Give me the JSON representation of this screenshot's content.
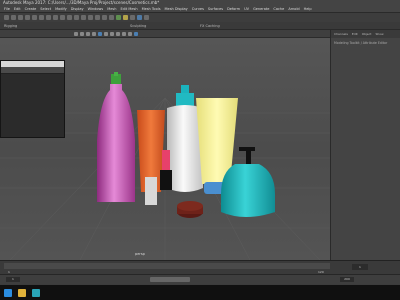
{
  "window": {
    "title": "Autodesk Maya 2017: C:/Users/.../3D/Maya Proj/Project/scenes/Cosmetics.mb*"
  },
  "menubar": {
    "items": [
      "File",
      "Edit",
      "Create",
      "Select",
      "Modify",
      "Display",
      "Windows",
      "Mesh",
      "Edit Mesh",
      "Mesh Tools",
      "Mesh Display",
      "Curves",
      "Surfaces",
      "Deform",
      "UV",
      "Generate",
      "Cache",
      "Arnold",
      "Help"
    ]
  },
  "tabs": {
    "left": "Rigging",
    "center": "Sculpting",
    "right": "FX Caching"
  },
  "panel_label": "persp",
  "right_panel": {
    "tabs": [
      "Channels",
      "Edit",
      "Object",
      "Show"
    ],
    "title": "Modeling Toolkit / Attribute Editor"
  },
  "timeline": {
    "start": "1",
    "end": "120",
    "range_start": "1",
    "range_end": "200",
    "frame": "1"
  },
  "colors": {
    "accent": "#5285a6",
    "viewport": "#505050",
    "panel": "#444444"
  },
  "icons": [
    "windows-start-icon",
    "file-explorer-icon",
    "maya-icon"
  ]
}
